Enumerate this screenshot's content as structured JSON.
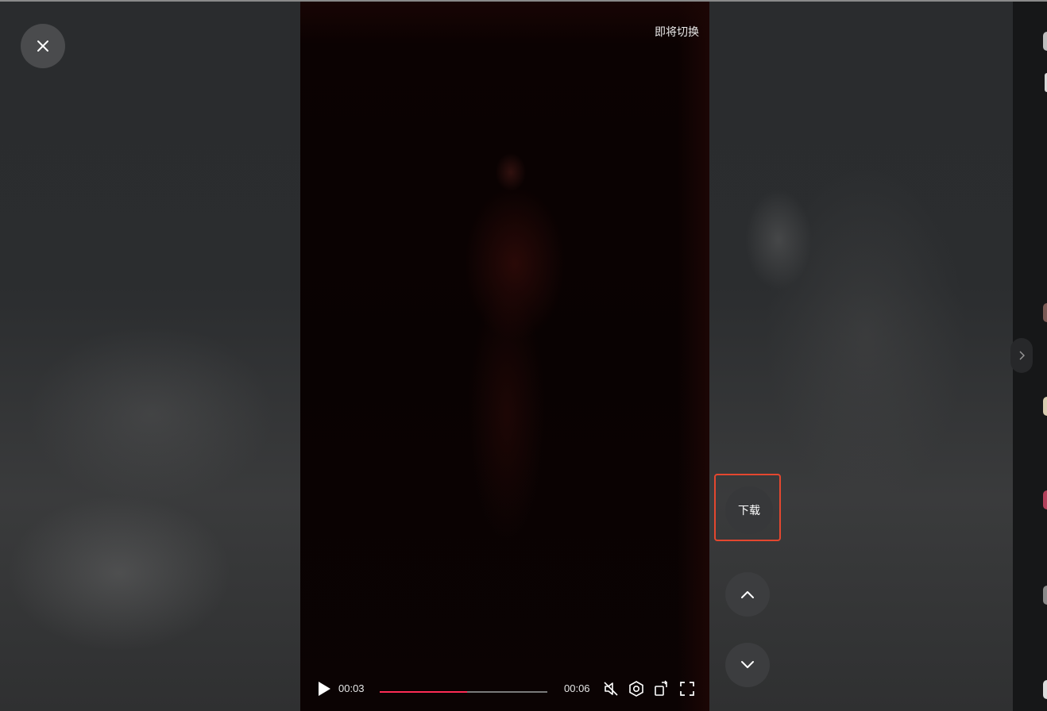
{
  "video": {
    "switch_label": "即将切换",
    "current_time": "00:03",
    "duration": "00:06",
    "progress_fraction": 0.52
  },
  "actions": {
    "download_label": "下载"
  },
  "colors": {
    "progress_accent": "#fe2c55",
    "highlight_border": "#e4472f"
  },
  "icons": {
    "close": "close-icon",
    "play": "play-icon",
    "mute": "muted-speaker-icon",
    "settings": "settings-icon",
    "rotate": "rotate-screen-icon",
    "fullscreen": "fullscreen-icon",
    "prev": "chevron-up-icon",
    "next": "chevron-down-icon",
    "expand": "chevron-right-icon"
  }
}
